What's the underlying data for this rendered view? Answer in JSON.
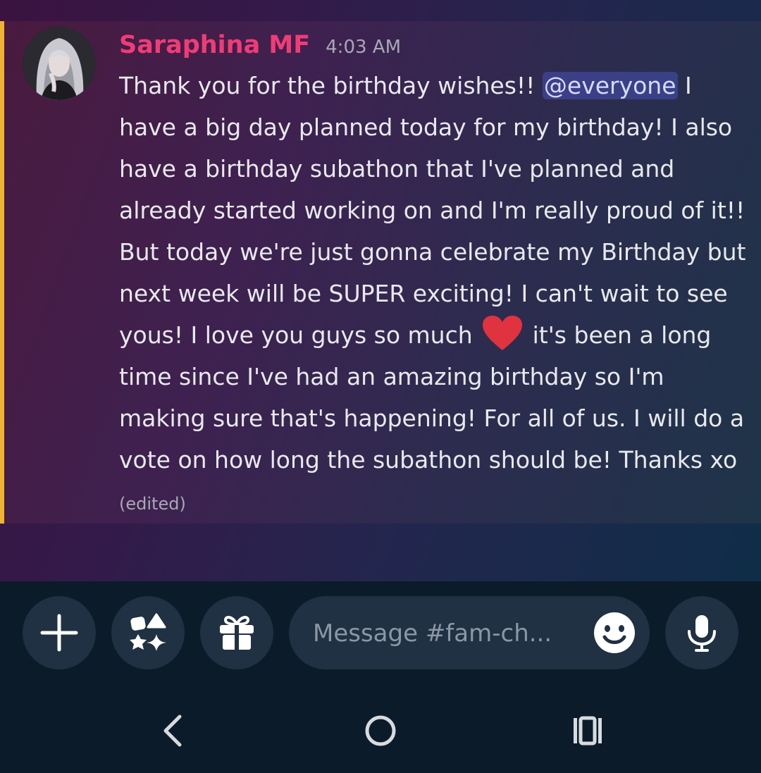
{
  "message": {
    "author": "Saraphina MF",
    "timestamp": "4:03 AM",
    "text_before_mention": "Thank you for the birthday wishes!! ",
    "mention": "@everyone",
    "text_after_mention": " I have a big day planned today for my birthday! I also have a birthday subathon that I've planned and already started working on and I'm really proud of it!! But today we're just gonna celebrate my Birthday but next week will be SUPER exciting! I can't wait to see yous! I love you guys so much ",
    "emoji": "heart-emoji",
    "text_after_emoji": " it's been a long time since I've had an amazing birthday so I'm making sure that's happening! For all of us. I will do a vote on how long the subathon should be! Thanks xo ",
    "edited_label": "(edited)"
  },
  "composer": {
    "placeholder": "Message #fam-ch...",
    "buttons": [
      "plus-icon",
      "apps-icon",
      "gift-icon",
      "emoji-icon",
      "microphone-icon"
    ]
  },
  "nav_bar": {
    "buttons": [
      "back-icon",
      "home-icon",
      "recents-icon"
    ]
  },
  "colors": {
    "username": "#f13b75",
    "highlight_bar": "#f0b232",
    "mention_bg": "#4b4f8f",
    "heart": "#e0323f"
  }
}
